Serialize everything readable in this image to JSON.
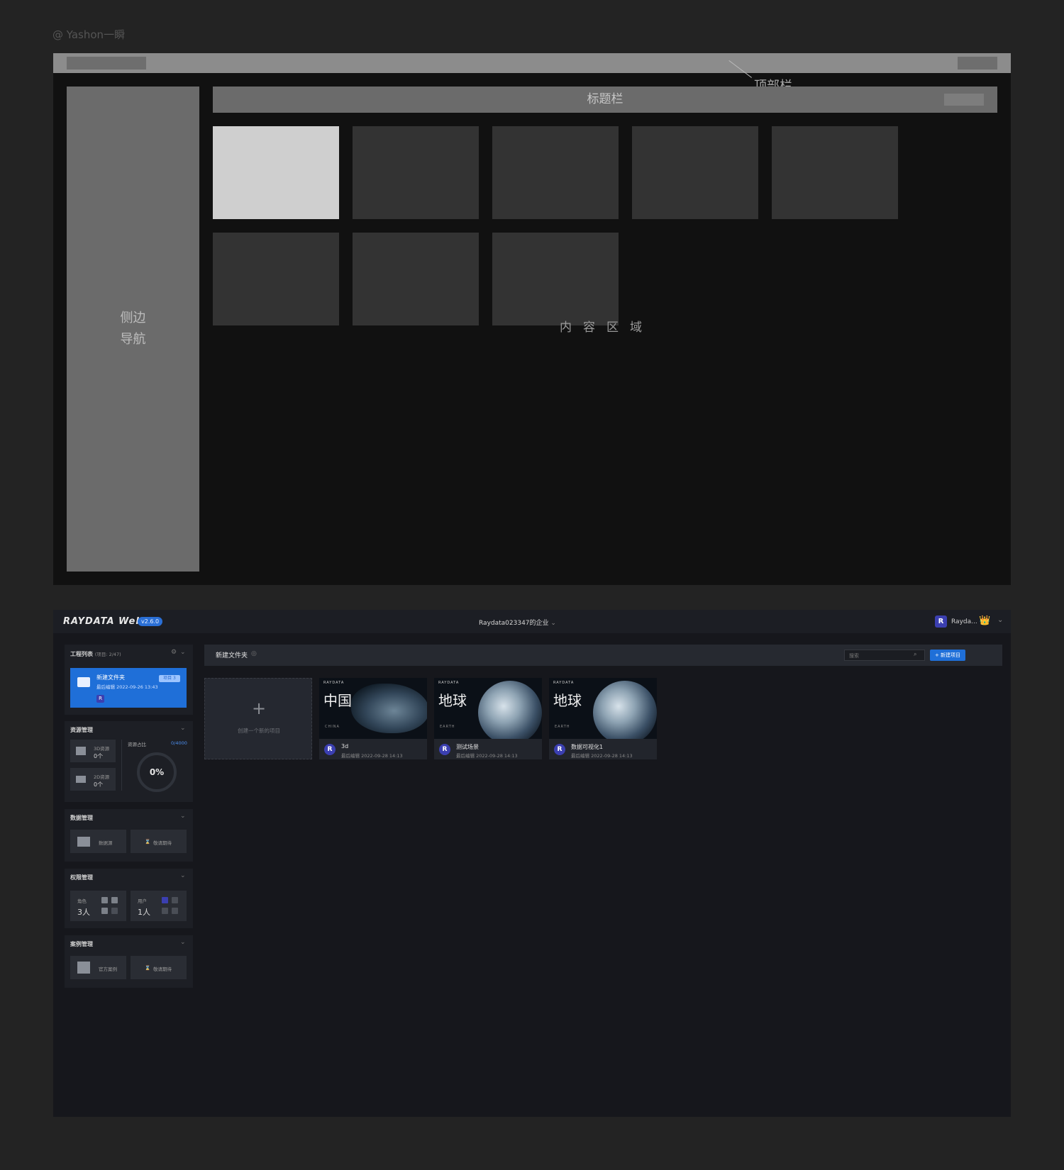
{
  "credit": "@ Yashon一瞬",
  "wireframe": {
    "top_bar_label": "顶部栏",
    "side_nav_line1": "侧边",
    "side_nav_line2": "导航",
    "title_bar_label": "标题栏",
    "content_label": "内容区域"
  },
  "app": {
    "brand": "RAYDATA Web",
    "version": "v2.6.0",
    "org": "Raydata023347的企业",
    "org_chevron": "⌄",
    "user": "Rayda...",
    "crown_icon": "👑",
    "user_chevron": "⌄",
    "user_avatar": "R",
    "sidebar": {
      "project_list": {
        "title": "工程列表",
        "count": "(项目: 2/47)",
        "card": {
          "name": "新建文件夹",
          "badge": "项目 3",
          "edited": "最后编辑 2022-09-26 13:43"
        }
      },
      "resources": {
        "title": "资源管理",
        "tile_3d_label": "3D资源",
        "tile_3d_value": "0个",
        "tile_2d_label": "2D资源",
        "tile_2d_value": "0个",
        "usage_label": "资源占比",
        "usage_count": "0/4000",
        "usage_percent": "0%"
      },
      "data": {
        "title": "数据管理",
        "btn_db": "数据源",
        "btn_wait": "敬请期待"
      },
      "permissions": {
        "title": "权限管理",
        "role_label": "角色",
        "role_value": "3人",
        "user_label": "用户",
        "user_value": "1人"
      },
      "cases": {
        "title": "案例管理",
        "btn_official": "官方案例",
        "btn_wait": "敬请期待"
      }
    },
    "main": {
      "folder_title": "新建文件夹",
      "search_placeholder": "搜索",
      "new_button": "+ 新建项目",
      "create_label": "创建一个新的项目",
      "projects": [
        {
          "thumb_title": "中国",
          "thumb_sub": "CHINA",
          "name": "3d",
          "edited": "最后编辑 2022-09-28 14:13"
        },
        {
          "thumb_title": "地球",
          "thumb_sub": "EARTH",
          "name": "测试场景",
          "edited": "最后编辑 2022-09-28 14:13"
        },
        {
          "thumb_title": "地球",
          "thumb_sub": "EARTH",
          "name": "数据可视化1",
          "edited": "最后编辑 2022-09-28 14:13"
        }
      ],
      "thumb_brand": "RAYDATA"
    }
  }
}
